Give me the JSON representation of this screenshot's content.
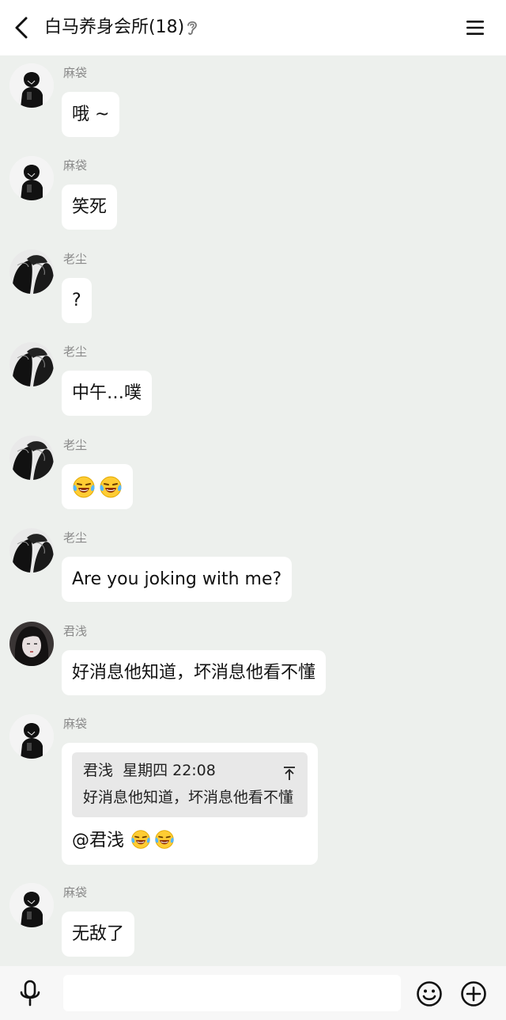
{
  "header": {
    "title": "白马养身会所(18)",
    "back_icon": "chevron-left-icon",
    "ear_icon": "ear-icon",
    "menu_icon": "hamburger-menu-icon"
  },
  "messages": [
    {
      "sender": "麻袋",
      "text": "哦 ~",
      "avatar": "avatar-madai"
    },
    {
      "sender": "麻袋",
      "text": "笑死",
      "avatar": "avatar-madai"
    },
    {
      "sender": "老尘",
      "text": "?",
      "avatar": "avatar-laochen"
    },
    {
      "sender": "老尘",
      "text": "中午…噗",
      "avatar": "avatar-laochen"
    },
    {
      "sender": "老尘",
      "emoji": [
        "laughing-crying-emoji",
        "laughing-crying-emoji"
      ],
      "avatar": "avatar-laochen"
    },
    {
      "sender": "老尘",
      "text": "Are you joking with me?",
      "avatar": "avatar-laochen"
    },
    {
      "sender": "君浅",
      "text": "好消息他知道，坏消息他看不懂",
      "avatar": "avatar-junqian"
    },
    {
      "sender": "麻袋",
      "avatar": "avatar-madai",
      "quote": {
        "author": "君浅",
        "time": "星期四 22:08",
        "text": "好消息他知道，坏消息他看不懂"
      },
      "text": "@君浅"
    },
    {
      "sender": "麻袋",
      "text": "无敌了",
      "avatar": "avatar-madai"
    }
  ],
  "input": {
    "value": "",
    "placeholder": ""
  },
  "bottom_icons": [
    "microphone-icon",
    "smiley-icon",
    "plus-circle-icon"
  ],
  "colors": {
    "background": "#edf0ed",
    "bubble": "#ffffff",
    "header": "#ffffff",
    "sender": "#8a8a8a"
  }
}
